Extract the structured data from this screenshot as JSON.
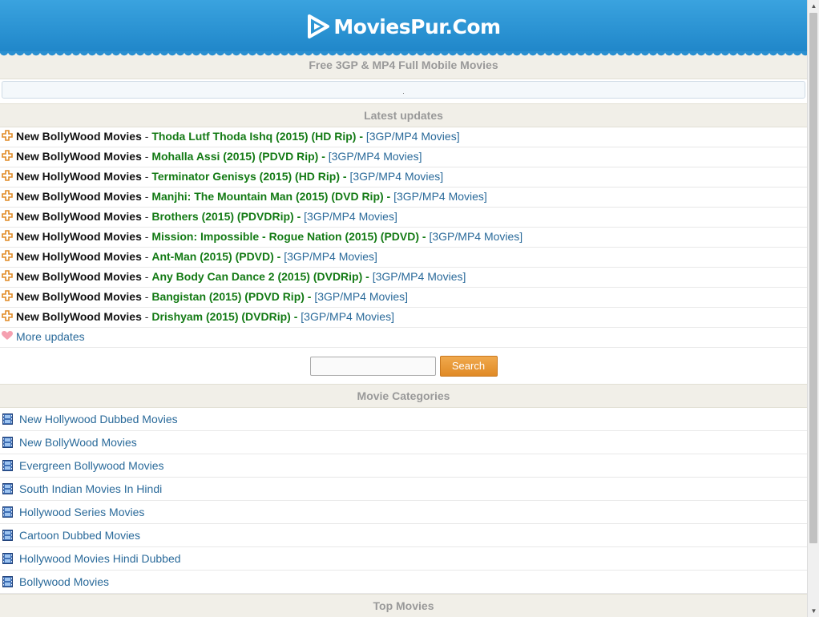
{
  "header": {
    "logo_text": "MoviesPur.Com",
    "tagline": "Free 3GP & MP4 Full Mobile Movies"
  },
  "notice": {
    "text": "."
  },
  "latest": {
    "heading": "Latest updates",
    "sep": " - ",
    "items": [
      {
        "category": "New BollyWood Movies",
        "title": "Thoda Lutf Thoda Ishq (2015) (HD Rip) -",
        "format": "[3GP/MP4 Movies]"
      },
      {
        "category": "New BollyWood Movies",
        "title": "Mohalla Assi (2015) (PDVD Rip) -",
        "format": "[3GP/MP4 Movies]"
      },
      {
        "category": "New HollyWood Movies",
        "title": "Terminator Genisys (2015) (HD Rip) -",
        "format": "[3GP/MP4 Movies]"
      },
      {
        "category": "New BollyWood Movies",
        "title": "Manjhi: The Mountain Man (2015) (DVD Rip) -",
        "format": "[3GP/MP4 Movies]"
      },
      {
        "category": "New BollyWood Movies",
        "title": "Brothers (2015) (PDVDRip) -",
        "format": "[3GP/MP4 Movies]"
      },
      {
        "category": "New HollyWood Movies",
        "title": "Mission: Impossible - Rogue Nation (2015) (PDVD) -",
        "format": "[3GP/MP4 Movies]"
      },
      {
        "category": "New HollyWood Movies",
        "title": "Ant-Man (2015) (PDVD) -",
        "format": "[3GP/MP4 Movies]"
      },
      {
        "category": "New BollyWood Movies",
        "title": "Any Body Can Dance 2 (2015) (DVDRip) -",
        "format": "[3GP/MP4 Movies]"
      },
      {
        "category": "New BollyWood Movies",
        "title": "Bangistan (2015) (PDVD Rip) -",
        "format": "[3GP/MP4 Movies]"
      },
      {
        "category": "New BollyWood Movies",
        "title": "Drishyam (2015) (DVDRip) -",
        "format": "[3GP/MP4 Movies]"
      }
    ],
    "more_label": "More updates"
  },
  "search": {
    "input_value": "",
    "button_label": "Search"
  },
  "categories": {
    "heading": "Movie Categories",
    "items": [
      "New Hollywood Dubbed Movies",
      "New BollyWood Movies",
      "Evergreen Bollywood Movies",
      "South Indian Movies In Hindi",
      "Hollywood Series Movies",
      "Cartoon Dubbed Movies",
      "Hollywood Movies Hindi Dubbed",
      "Bollywood Movies"
    ]
  },
  "top_movies": {
    "heading": "Top Movies"
  },
  "colors": {
    "header_blue": "#2a8fd0",
    "title_green": "#137a14",
    "link_blue": "#2a6a9a",
    "button_orange": "#e8962f",
    "section_bg": "#f1efe8"
  },
  "icons": {
    "logo": "play-icon",
    "update_bullet": "plus-icon",
    "more_bullet": "heart-icon",
    "category_bullet": "film-icon"
  }
}
